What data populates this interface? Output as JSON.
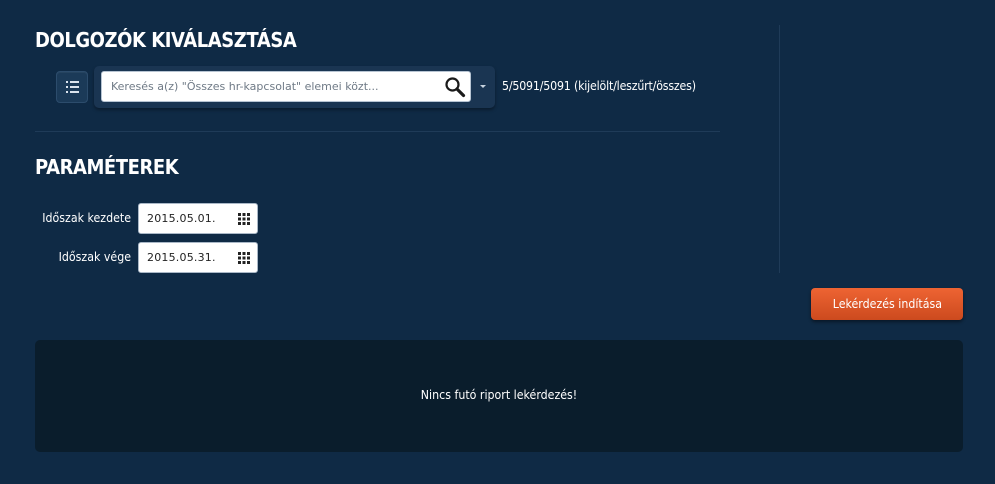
{
  "workers_section": {
    "title": "DOLGOZÓK KIVÁLASZTÁSA",
    "search": {
      "placeholder": "Keresés a(z) \"Összes hr-kapcsolat\" elemei közt...",
      "value": ""
    },
    "selection_count": "5/5091/5091 (kijelölt/leszűrt/összes)"
  },
  "params_section": {
    "title": "PARAMÉTEREK",
    "period_start_label": "Időszak kezdete",
    "period_start_value": "2015.05.01.",
    "period_end_label": "Időszak vége",
    "period_end_value": "2015.05.31."
  },
  "actions": {
    "run_label": "Lekérdezés indítása"
  },
  "report": {
    "message": "Nincs futó riport lekérdezés!"
  },
  "icons": {
    "list": "list-icon",
    "search": "search-icon",
    "dropdown": "chevron-down-icon",
    "calendar": "calendar-icon"
  },
  "colors": {
    "background": "#0f2a45",
    "panel": "#0a1d2c",
    "accent_button": "#e35a2a"
  }
}
